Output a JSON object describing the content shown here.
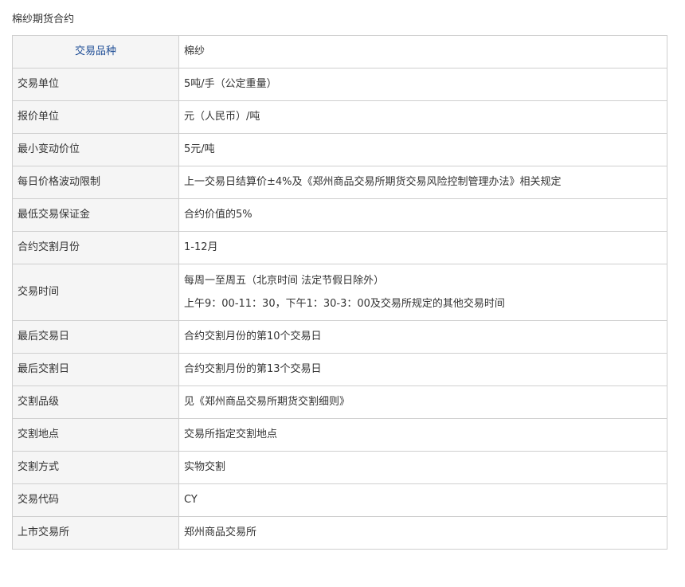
{
  "page": {
    "title": "棉纱期货合约"
  },
  "table": {
    "rows": [
      {
        "label": "交易品种",
        "value": "棉纱"
      },
      {
        "label": "交易单位",
        "value": "5吨/手（公定重量）"
      },
      {
        "label": "报价单位",
        "value": "元（人民币）/吨"
      },
      {
        "label": "最小变动价位",
        "value": "5元/吨"
      },
      {
        "label": "每日价格波动限制",
        "value": "上一交易日结算价±4%及《郑州商品交易所期货交易风险控制管理办法》相关规定"
      },
      {
        "label": "最低交易保证金",
        "value": "合约价值的5%"
      },
      {
        "label": "合约交割月份",
        "value": "1-12月"
      },
      {
        "label": "交易时间",
        "value_lines": [
          "每周一至周五（北京时间 法定节假日除外）",
          "上午9：00-11：30，下午1：30-3：00及交易所规定的其他交易时间"
        ]
      },
      {
        "label": "最后交易日",
        "value": "合约交割月份的第10个交易日"
      },
      {
        "label": "最后交割日",
        "value": "合约交割月份的第13个交易日"
      },
      {
        "label": "交割品级",
        "value": "见《郑州商品交易所期货交割细则》"
      },
      {
        "label": "交割地点",
        "value": "交易所指定交割地点"
      },
      {
        "label": "交割方式",
        "value": "实物交割"
      },
      {
        "label": "交易代码",
        "value": "CY"
      },
      {
        "label": "上市交易所",
        "value": "郑州商品交易所"
      }
    ]
  },
  "colors": {
    "header_label": "#1f4e96",
    "label_bg": "#f5f5f5",
    "border": "#cfcfcf",
    "text": "#333333"
  }
}
